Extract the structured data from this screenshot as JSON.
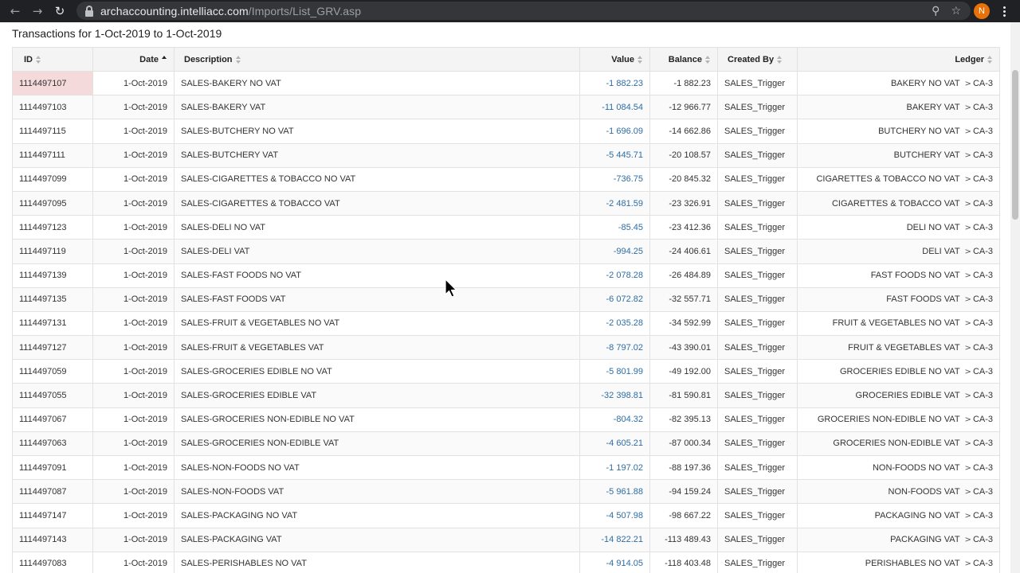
{
  "browser": {
    "url_host": "archaccounting.intelliacc.com",
    "url_path": "/Imports/List_GRV.asp",
    "back_icon": "arrow-left-icon",
    "forward_icon": "arrow-right-icon",
    "reload_icon": "reload-icon",
    "zoom_icon": "zoom-icon",
    "bookmark_icon": "star-icon",
    "profile_initial": "N",
    "profile_color": "#e8710a"
  },
  "page": {
    "title": "Transactions for 1-Oct-2019 to 1-Oct-2019"
  },
  "table": {
    "columns": {
      "id": "ID",
      "date": "Date",
      "description": "Description",
      "value": "Value",
      "balance": "Balance",
      "created_by": "Created By",
      "ledger": "Ledger"
    },
    "ledger_separator": ">",
    "rows": [
      {
        "id": "1114497107",
        "date": "1-Oct-2019",
        "description": "SALES-BAKERY NO VAT",
        "value": "-1 882.23",
        "balance": "-1 882.23",
        "created_by": "SALES_Trigger",
        "ledger_name": "BAKERY NO VAT",
        "ledger_code": "CA-3"
      },
      {
        "id": "1114497103",
        "date": "1-Oct-2019",
        "description": "SALES-BAKERY VAT",
        "value": "-11 084.54",
        "balance": "-12 966.77",
        "created_by": "SALES_Trigger",
        "ledger_name": "BAKERY VAT",
        "ledger_code": "CA-3"
      },
      {
        "id": "1114497115",
        "date": "1-Oct-2019",
        "description": "SALES-BUTCHERY NO VAT",
        "value": "-1 696.09",
        "balance": "-14 662.86",
        "created_by": "SALES_Trigger",
        "ledger_name": "BUTCHERY NO VAT",
        "ledger_code": "CA-3"
      },
      {
        "id": "1114497111",
        "date": "1-Oct-2019",
        "description": "SALES-BUTCHERY VAT",
        "value": "-5 445.71",
        "balance": "-20 108.57",
        "created_by": "SALES_Trigger",
        "ledger_name": "BUTCHERY VAT",
        "ledger_code": "CA-3"
      },
      {
        "id": "1114497099",
        "date": "1-Oct-2019",
        "description": "SALES-CIGARETTES & TOBACCO NO VAT",
        "value": "-736.75",
        "balance": "-20 845.32",
        "created_by": "SALES_Trigger",
        "ledger_name": "CIGARETTES & TOBACCO NO VAT",
        "ledger_code": "CA-3"
      },
      {
        "id": "1114497095",
        "date": "1-Oct-2019",
        "description": "SALES-CIGARETTES & TOBACCO VAT",
        "value": "-2 481.59",
        "balance": "-23 326.91",
        "created_by": "SALES_Trigger",
        "ledger_name": "CIGARETTES & TOBACCO VAT",
        "ledger_code": "CA-3"
      },
      {
        "id": "1114497123",
        "date": "1-Oct-2019",
        "description": "SALES-DELI NO VAT",
        "value": "-85.45",
        "balance": "-23 412.36",
        "created_by": "SALES_Trigger",
        "ledger_name": "DELI NO VAT",
        "ledger_code": "CA-3"
      },
      {
        "id": "1114497119",
        "date": "1-Oct-2019",
        "description": "SALES-DELI VAT",
        "value": "-994.25",
        "balance": "-24 406.61",
        "created_by": "SALES_Trigger",
        "ledger_name": "DELI VAT",
        "ledger_code": "CA-3"
      },
      {
        "id": "1114497139",
        "date": "1-Oct-2019",
        "description": "SALES-FAST FOODS NO VAT",
        "value": "-2 078.28",
        "balance": "-26 484.89",
        "created_by": "SALES_Trigger",
        "ledger_name": "FAST FOODS NO VAT",
        "ledger_code": "CA-3"
      },
      {
        "id": "1114497135",
        "date": "1-Oct-2019",
        "description": "SALES-FAST FOODS VAT",
        "value": "-6 072.82",
        "balance": "-32 557.71",
        "created_by": "SALES_Trigger",
        "ledger_name": "FAST FOODS VAT",
        "ledger_code": "CA-3"
      },
      {
        "id": "1114497131",
        "date": "1-Oct-2019",
        "description": "SALES-FRUIT & VEGETABLES NO VAT",
        "value": "-2 035.28",
        "balance": "-34 592.99",
        "created_by": "SALES_Trigger",
        "ledger_name": "FRUIT & VEGETABLES NO VAT",
        "ledger_code": "CA-3"
      },
      {
        "id": "1114497127",
        "date": "1-Oct-2019",
        "description": "SALES-FRUIT & VEGETABLES VAT",
        "value": "-8 797.02",
        "balance": "-43 390.01",
        "created_by": "SALES_Trigger",
        "ledger_name": "FRUIT & VEGETABLES VAT",
        "ledger_code": "CA-3"
      },
      {
        "id": "1114497059",
        "date": "1-Oct-2019",
        "description": "SALES-GROCERIES EDIBLE NO VAT",
        "value": "-5 801.99",
        "balance": "-49 192.00",
        "created_by": "SALES_Trigger",
        "ledger_name": "GROCERIES EDIBLE NO VAT",
        "ledger_code": "CA-3"
      },
      {
        "id": "1114497055",
        "date": "1-Oct-2019",
        "description": "SALES-GROCERIES EDIBLE VAT",
        "value": "-32 398.81",
        "balance": "-81 590.81",
        "created_by": "SALES_Trigger",
        "ledger_name": "GROCERIES EDIBLE VAT",
        "ledger_code": "CA-3"
      },
      {
        "id": "1114497067",
        "date": "1-Oct-2019",
        "description": "SALES-GROCERIES NON-EDIBLE NO VAT",
        "value": "-804.32",
        "balance": "-82 395.13",
        "created_by": "SALES_Trigger",
        "ledger_name": "GROCERIES NON-EDIBLE NO VAT",
        "ledger_code": "CA-3"
      },
      {
        "id": "1114497063",
        "date": "1-Oct-2019",
        "description": "SALES-GROCERIES NON-EDIBLE VAT",
        "value": "-4 605.21",
        "balance": "-87 000.34",
        "created_by": "SALES_Trigger",
        "ledger_name": "GROCERIES NON-EDIBLE VAT",
        "ledger_code": "CA-3"
      },
      {
        "id": "1114497091",
        "date": "1-Oct-2019",
        "description": "SALES-NON-FOODS NO VAT",
        "value": "-1 197.02",
        "balance": "-88 197.36",
        "created_by": "SALES_Trigger",
        "ledger_name": "NON-FOODS NO VAT",
        "ledger_code": "CA-3"
      },
      {
        "id": "1114497087",
        "date": "1-Oct-2019",
        "description": "SALES-NON-FOODS VAT",
        "value": "-5 961.88",
        "balance": "-94 159.24",
        "created_by": "SALES_Trigger",
        "ledger_name": "NON-FOODS VAT",
        "ledger_code": "CA-3"
      },
      {
        "id": "1114497147",
        "date": "1-Oct-2019",
        "description": "SALES-PACKAGING NO VAT",
        "value": "-4 507.98",
        "balance": "-98 667.22",
        "created_by": "SALES_Trigger",
        "ledger_name": "PACKAGING NO VAT",
        "ledger_code": "CA-3"
      },
      {
        "id": "1114497143",
        "date": "1-Oct-2019",
        "description": "SALES-PACKAGING VAT",
        "value": "-14 822.21",
        "balance": "-113 489.43",
        "created_by": "SALES_Trigger",
        "ledger_name": "PACKAGING VAT",
        "ledger_code": "CA-3"
      },
      {
        "id": "1114497083",
        "date": "1-Oct-2019",
        "description": "SALES-PERISHABLES NO VAT",
        "value": "-4 914.05",
        "balance": "-118 403.48",
        "created_by": "SALES_Trigger",
        "ledger_name": "PERISHABLES NO VAT",
        "ledger_code": "CA-3"
      }
    ]
  }
}
